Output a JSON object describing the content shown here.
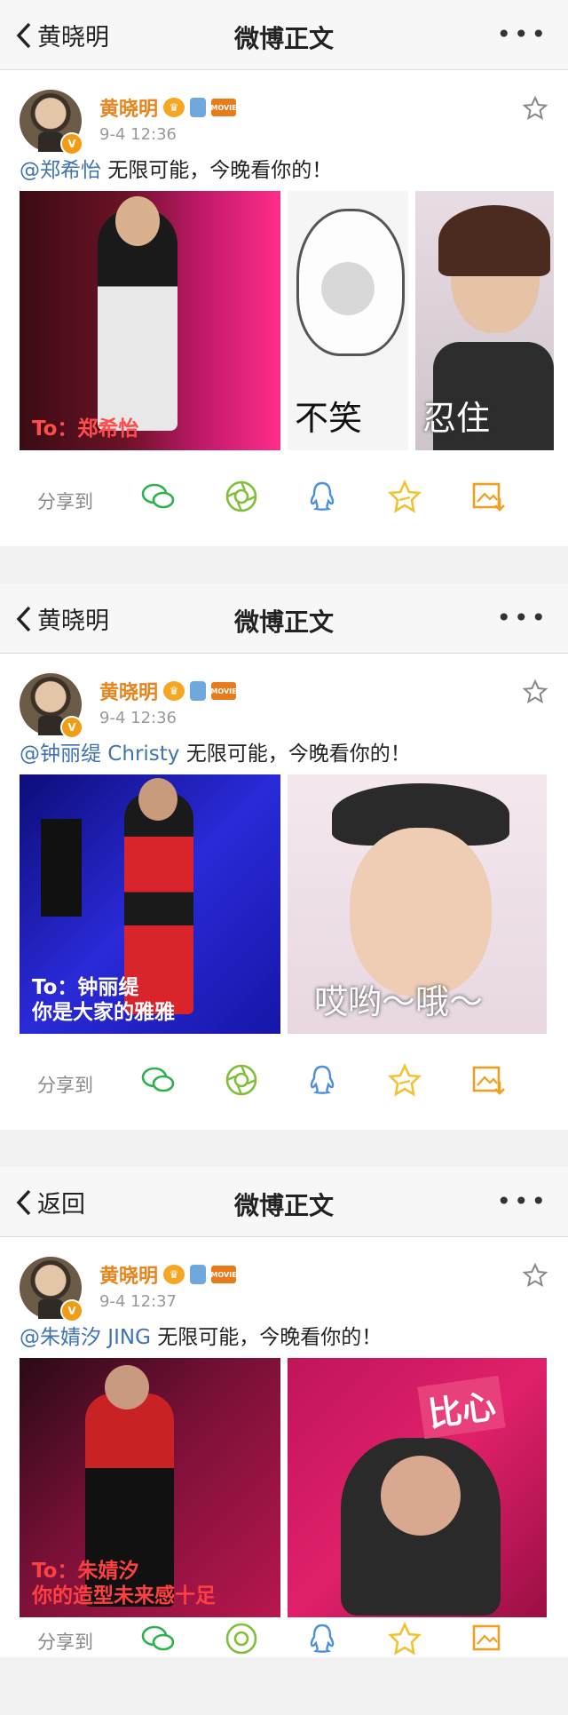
{
  "posts": [
    {
      "nav": {
        "back_label": "黄晓明",
        "title": "微博正文",
        "more": "•••"
      },
      "user": {
        "name": "黄晓明",
        "badge": "V",
        "movie_badge": "MOVIE"
      },
      "time": "9-4 12:36",
      "mention": "@郑希怡",
      "text": " 无限可能，今晚看你的！",
      "images": [
        {
          "caption": "To：郑希怡",
          "caption_color": "#ff4d4d"
        },
        {
          "caption": "不笑",
          "caption_color": "#111111"
        },
        {
          "caption": "忍住",
          "caption_color": "#ffffff"
        }
      ],
      "share_label": "分享到"
    },
    {
      "nav": {
        "back_label": "黄晓明",
        "title": "微博正文",
        "more": "•••"
      },
      "user": {
        "name": "黄晓明",
        "badge": "V",
        "movie_badge": "MOVIE"
      },
      "time": "9-4 12:36",
      "mention": "@钟丽缇 Christy",
      "text": " 无限可能，今晚看你的！",
      "images": [
        {
          "caption": "To：钟丽缇\n你是大家的雅雅",
          "caption_color": "#ffffff"
        },
        {
          "caption": "哎哟～哦～",
          "caption_color": "#ffffff"
        }
      ],
      "share_label": "分享到"
    },
    {
      "nav": {
        "back_label": "返回",
        "title": "微博正文",
        "more": "•••"
      },
      "user": {
        "name": "黄晓明",
        "badge": "V",
        "movie_badge": "MOVIE"
      },
      "time": "9-4 12:37",
      "mention": "@朱婧汐 JING",
      "text": " 无限可能，今晚看你的！",
      "images": [
        {
          "caption": "To：朱婧汐\n你的造型未来感十足",
          "caption_color": "#ff4040"
        },
        {
          "caption": "比心",
          "caption_color": "#ffffff"
        }
      ],
      "share_label": "分享到"
    }
  ],
  "icons": [
    "chevron-left-icon",
    "crown-icon",
    "bag-icon",
    "movie-icon",
    "star-outline-icon",
    "wechat-icon",
    "moments-icon",
    "qq-icon",
    "favorite-star-icon",
    "save-image-icon"
  ],
  "colors": {
    "username": "#e8841d",
    "mention": "#3f73b3",
    "time": "#999999",
    "wechat": "#2bb24c",
    "moments": "#7fbf3a",
    "qq": "#4a8fe0",
    "favorite": "#f2c230",
    "save": "#f0a020"
  }
}
